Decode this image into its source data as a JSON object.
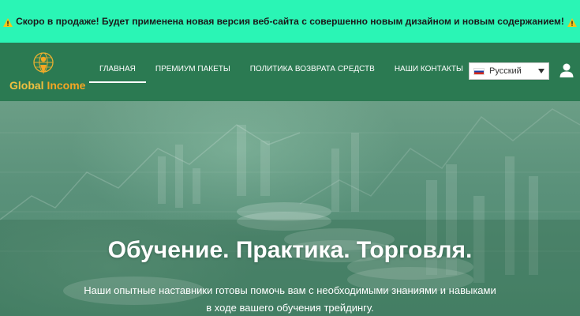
{
  "announcement": {
    "text": "Скоро в продаже! Будет применена новая версия веб-сайта с совершенно новым дизайном и новым содержанием!",
    "icon": "warning-icon"
  },
  "logo": {
    "word1": "Global",
    "word2": "Income"
  },
  "nav": {
    "items": [
      {
        "label": "ГЛАВНАЯ",
        "active": true
      },
      {
        "label": "ПРЕМИУМ ПАКЕТЫ",
        "active": false
      },
      {
        "label": "ПОЛИТИКА ВОЗВРАТА СРЕДСТВ",
        "active": false
      },
      {
        "label": "НАШИ КОНТАКТЫ",
        "active": false
      }
    ]
  },
  "language": {
    "selected": "Русский",
    "flag": "russia-flag-icon"
  },
  "hero": {
    "title": "Обучение. Практика. Торговля.",
    "subtitle": "Наши опытные наставники готовы помочь вам с необходимыми знаниями и навыками в ходе вашего обучения трейдингу."
  },
  "colors": {
    "announce_bg": "#2af5b5",
    "nav_bg": "#2b7a52",
    "hero_tint": "#5a917a",
    "logo_gold": "#f5a623"
  }
}
